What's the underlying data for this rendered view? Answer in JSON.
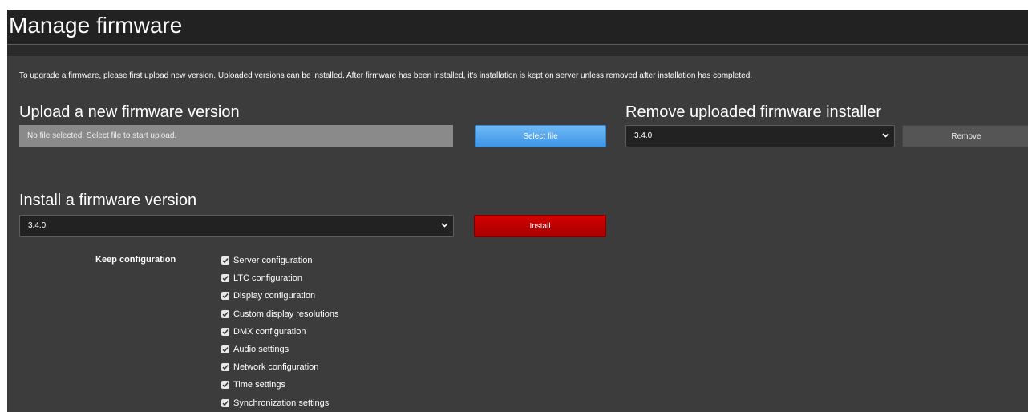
{
  "header": {
    "title": "Manage firmware"
  },
  "intro_text": "To upgrade a firmware, please first upload new version. Uploaded versions can be installed. After firmware has been installed, it's installation is kept on server unless removed after installation has completed.",
  "upload": {
    "heading": "Upload a new firmware version",
    "file_status": "No file selected. Select file to start upload.",
    "select_button_label": "Select file"
  },
  "remove": {
    "heading": "Remove uploaded firmware installer",
    "selected_version": "3.4.0",
    "remove_button_label": "Remove"
  },
  "install": {
    "heading": "Install a firmware version",
    "selected_version": "3.4.0",
    "install_button_label": "Install",
    "keep_label": "Keep configuration",
    "options": [
      {
        "label": "Server configuration",
        "checked": true
      },
      {
        "label": "LTC configuration",
        "checked": true
      },
      {
        "label": "Display configuration",
        "checked": true
      },
      {
        "label": "Custom display resolutions",
        "checked": true
      },
      {
        "label": "DMX configuration",
        "checked": true
      },
      {
        "label": "Audio settings",
        "checked": true
      },
      {
        "label": "Network configuration",
        "checked": true
      },
      {
        "label": "Time settings",
        "checked": true
      },
      {
        "label": "Synchronization settings",
        "checked": true
      }
    ]
  },
  "colors": {
    "background": "#3c3c3c",
    "title_bar": "#222222",
    "select_button": "#4fa3ee",
    "install_button": "#c00000",
    "remove_button": "#555555"
  },
  "icons": {
    "dropdown": "chevron-down-icon",
    "checkbox": "checkmark-icon"
  }
}
